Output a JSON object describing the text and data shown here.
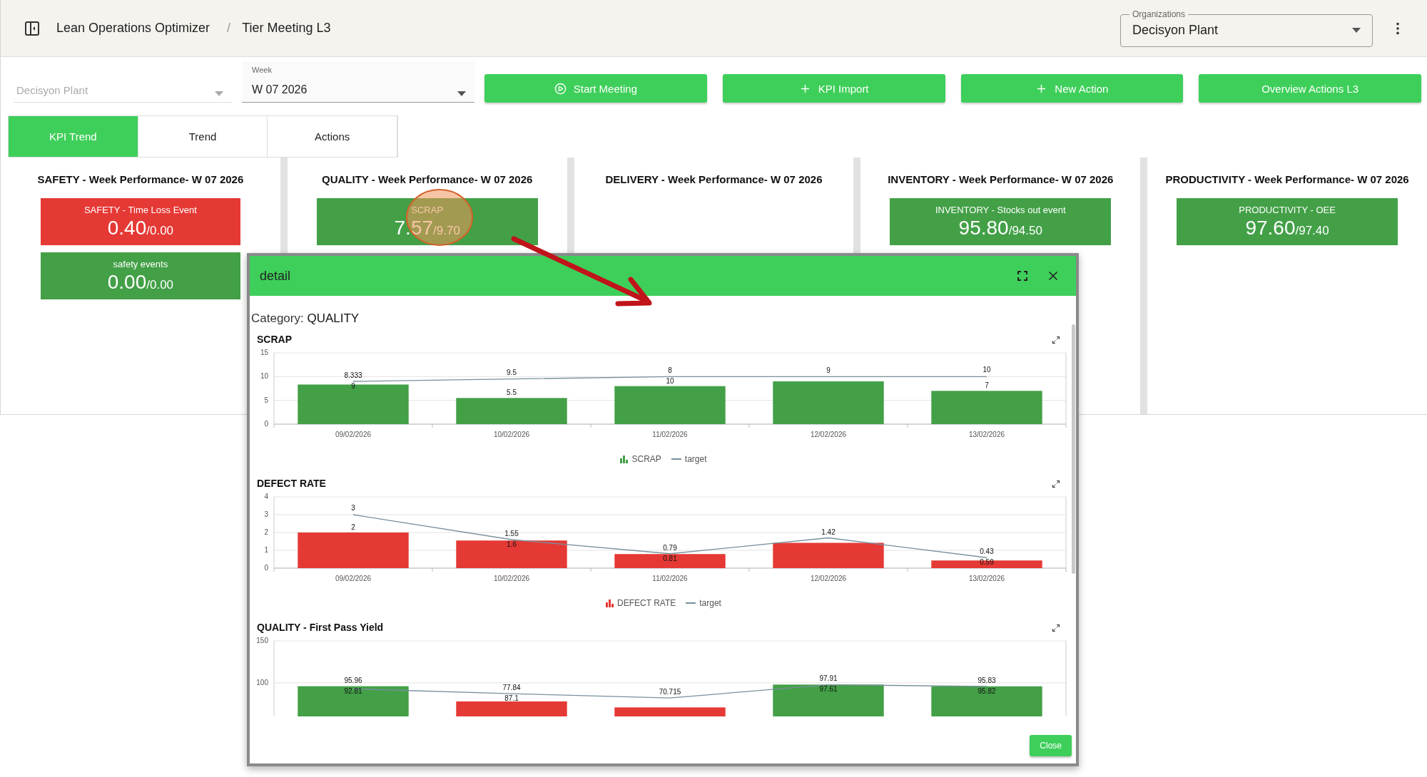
{
  "header": {
    "breadcrumbs": [
      "Lean Operations Optimizer",
      "Tier Meeting L3"
    ],
    "separator": "/",
    "organization": {
      "label": "Organizations",
      "value": "Decisyon Plant"
    }
  },
  "filters": {
    "plant": {
      "placeholder": "Decisyon Plant",
      "disabled": true
    },
    "week": {
      "label": "Week",
      "value": "W 07 2026"
    }
  },
  "actions": [
    {
      "label": "Start Meeting",
      "kind": "play"
    },
    {
      "label": "KPI Import",
      "kind": "plus"
    },
    {
      "label": "New Action",
      "kind": "plus"
    },
    {
      "label": "Overview Actions L3",
      "kind": "text"
    }
  ],
  "tabs": [
    {
      "label": "KPI Trend",
      "selected": true
    },
    {
      "label": "Trend",
      "selected": false
    },
    {
      "label": "Actions",
      "selected": false
    }
  ],
  "columns": [
    {
      "title": "SAFETY - Week Performance- W 07 2026",
      "cards": [
        {
          "label": "SAFETY - Time Loss Event",
          "value": "0.40",
          "target": "/0.00",
          "color": "#e53935"
        },
        {
          "label": "safety events",
          "value": "0.00",
          "target": "/0.00",
          "color": "#43a047"
        }
      ]
    },
    {
      "title": "QUALITY - Week Performance- W 07 2026",
      "cards": [
        {
          "label": "SCRAP",
          "value": "7.57",
          "target": "/9.70",
          "color": "#43a047"
        }
      ]
    },
    {
      "title": "DELIVERY - Week Performance- W 07 2026"
    },
    {
      "title": "INVENTORY - Week Performance- W 07 2026",
      "cards": [
        {
          "label": "INVENTORY - Stocks out event",
          "value": "95.80",
          "target": "/94.50",
          "color": "#43a047"
        }
      ]
    },
    {
      "title": "PRODUCTIVITY - Week Performance- W 07 2026",
      "cards": [
        {
          "label": "PRODUCTIVITY - OEE",
          "value": "97.60",
          "target": "/97.40",
          "color": "#43a047"
        }
      ]
    }
  ],
  "dialog": {
    "title": "detail",
    "category_label": "Category:",
    "category": "QUALITY",
    "close": "Close",
    "charts": [
      {
        "title": "SCRAP",
        "chart_data": {
          "type": "bar",
          "categories": [
            "09/02/2026",
            "10/02/2026",
            "11/02/2026",
            "12/02/2026",
            "13/02/2026"
          ],
          "ylim": [
            0,
            15
          ],
          "yticks": [
            0,
            5,
            10,
            15
          ],
          "grid": true,
          "series": [
            {
              "name": "SCRAP",
              "type": "bar",
              "color": "#43a047",
              "values": [
                8.333,
                5.5,
                8,
                9,
                7
              ]
            },
            {
              "name": "target",
              "type": "line",
              "color": "#78909c",
              "values": [
                9,
                9.5,
                10,
                10,
                10
              ]
            }
          ],
          "value_labels": [
            [
              "8.333",
              "5.5",
              "8",
              "9",
              "7"
            ],
            [
              "9",
              "9.5",
              "10",
              null,
              "10"
            ]
          ]
        }
      },
      {
        "title": "DEFECT RATE",
        "chart_data": {
          "type": "bar",
          "categories": [
            "09/02/2026",
            "10/02/2026",
            "11/02/2026",
            "12/02/2026",
            "13/02/2026"
          ],
          "ylim": [
            0,
            4
          ],
          "yticks": [
            0,
            1,
            2,
            3,
            4
          ],
          "grid": true,
          "series": [
            {
              "name": "DEFECT RATE",
              "type": "bar",
              "color": "#e53935",
              "values": [
                2,
                1.55,
                0.79,
                1.42,
                0.43
              ]
            },
            {
              "name": "target",
              "type": "line",
              "color": "#78909c",
              "values": [
                3,
                1.6,
                0.81,
                1.7,
                0.59
              ]
            }
          ],
          "value_labels": [
            [
              "2",
              "1.55",
              "0.79",
              "1.42",
              "0.43"
            ],
            [
              "3",
              "1.6",
              "0.81",
              null,
              "0.59"
            ]
          ]
        }
      },
      {
        "title": "QUALITY - First Pass Yield",
        "chart_data": {
          "type": "bar",
          "ylim": [
            60,
            150
          ],
          "yticks": [
            100,
            150
          ],
          "grid": true,
          "series": [
            {
              "type": "bar",
              "colors": [
                "#43a047",
                "#e53935",
                "#e53935",
                "#43a047",
                "#43a047"
              ],
              "values": [
                95.96,
                77.84,
                70.715,
                97.91,
                95.83
              ]
            },
            {
              "type": "line",
              "color": "#78909c",
              "values": [
                92.81,
                87.1,
                82,
                97.61,
                95.82
              ]
            }
          ],
          "value_labels": [
            [
              "95.96",
              "77.84",
              "70.715",
              "97.91",
              "95.83"
            ],
            [
              "92.81",
              "87.1",
              null,
              "97.61",
              "95.82"
            ]
          ]
        }
      }
    ]
  }
}
